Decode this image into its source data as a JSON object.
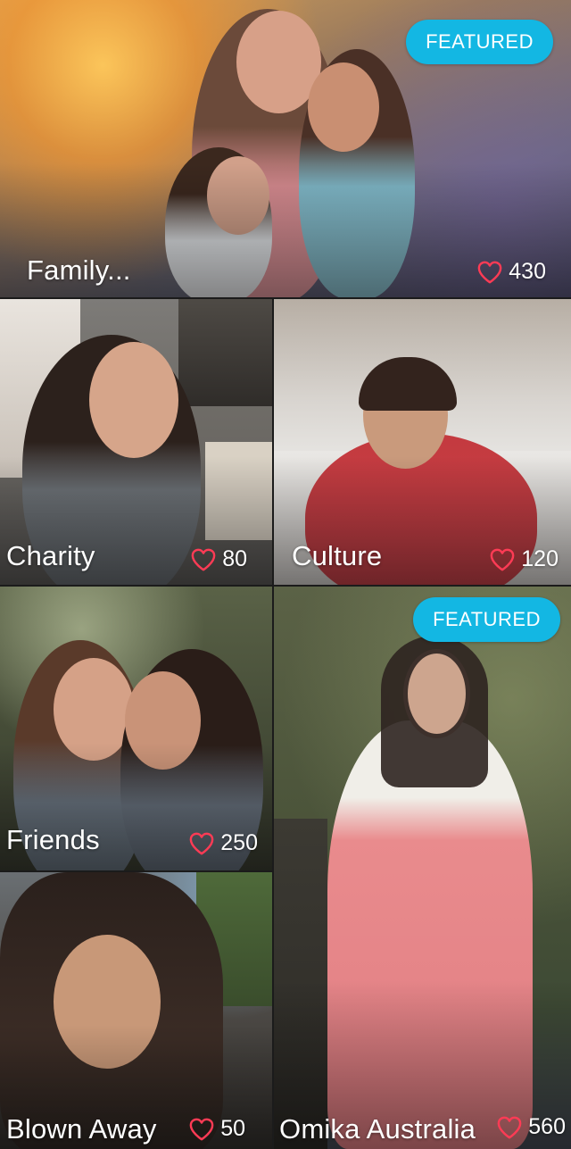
{
  "colors": {
    "featured_badge": "#13b7e3",
    "text": "#ffffff"
  },
  "tiles": [
    {
      "title": "Family...",
      "likes": "430",
      "featured": true,
      "featured_label": "FEATURED"
    },
    {
      "title": "Charity",
      "likes": "80",
      "featured": false
    },
    {
      "title": "Culture",
      "likes": "120",
      "featured": false
    },
    {
      "title": "Friends",
      "likes": "250",
      "featured": false
    },
    {
      "title": "Omika Australia",
      "likes": "560",
      "featured": true,
      "featured_label": "FEATURED"
    },
    {
      "title": "Blown Away",
      "likes": "50",
      "featured": false
    }
  ],
  "icons": {
    "like": "heart-outline-icon"
  }
}
